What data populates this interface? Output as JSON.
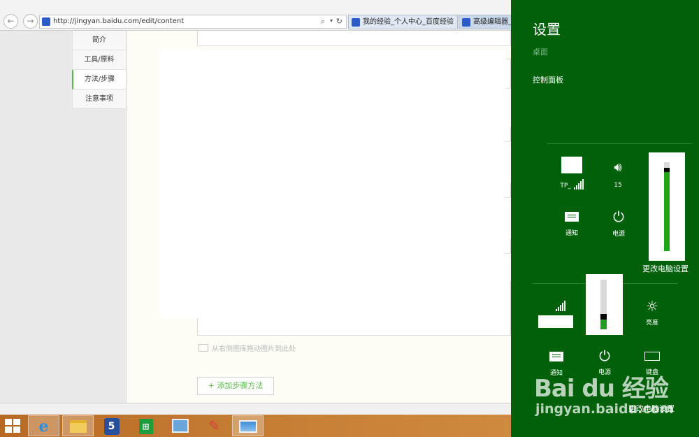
{
  "browser": {
    "back_icon": "arrow-left-icon",
    "forward_icon": "arrow-right-icon",
    "url": "http://jingyan.baidu.com/edit/content",
    "tabs": [
      {
        "title": "我的经验_个人中心_百度经验"
      },
      {
        "title": "高级编辑器_百"
      }
    ]
  },
  "page": {
    "side_nav": [
      "简介",
      "工具/原料",
      "方法/步骤",
      "注意事项"
    ],
    "drag_hint": "从右侧图库拖动图片到此处",
    "add_step": "+ 添加步骤方法"
  },
  "charm": {
    "title": "设置",
    "desktop": "桌面",
    "control_panel": "控制面板",
    "panel1": {
      "network_label": "TP_",
      "volume_value": "15",
      "notify": "通知",
      "power": "电源",
      "change_pc": "更改电脑设置",
      "volume_level": 0.92
    },
    "panel2": {
      "brightness": "亮度",
      "notify": "通知",
      "power": "电源",
      "keyboard": "键盘",
      "change_pc": "更改电脑设置",
      "volume_level": 0.28
    }
  },
  "watermark": {
    "logo": "Bai du 经验",
    "url": "jingyan.baidu.com"
  },
  "colors": {
    "charm_bg": "#00610a",
    "slider_fill": "#1fa21a",
    "accent_green": "#5bb94a",
    "taskbar": "#c57d34"
  }
}
